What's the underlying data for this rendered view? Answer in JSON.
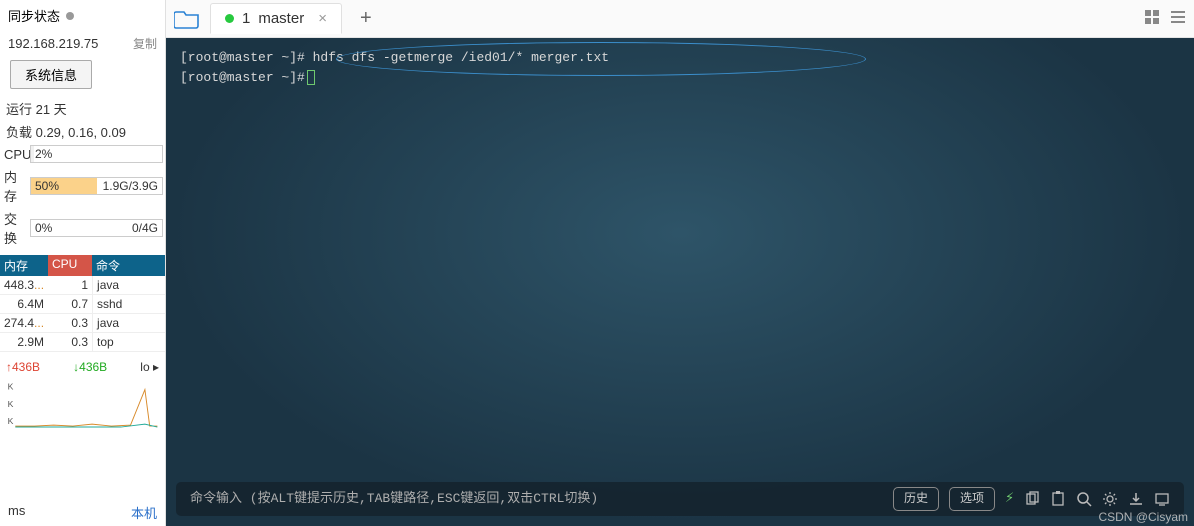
{
  "sidebar": {
    "sync_label": "同步状态",
    "ip": "192.168.219.75",
    "copy_label": "复制",
    "sys_info_btn": "系统信息",
    "uptime": "运行 21 天",
    "load": "负载 0.29, 0.16, 0.09",
    "cpu_label": "CPU",
    "cpu_pct": "2%",
    "mem_label": "内存",
    "mem_pct": "50%",
    "mem_detail": "1.9G/3.9G",
    "swap_label": "交换",
    "swap_pct": "0%",
    "swap_detail": "0/4G",
    "proc_headers": {
      "mem": "内存",
      "cpu": "CPU",
      "cmd": "命令"
    },
    "procs": [
      {
        "mem": "448.3",
        "cpu": "1",
        "cmd": "java"
      },
      {
        "mem": "6.4M",
        "cpu": "0.7",
        "cmd": "sshd"
      },
      {
        "mem": "274.4",
        "cpu": "0.3",
        "cmd": "java"
      },
      {
        "mem": "2.9M",
        "cpu": "0.3",
        "cmd": "top"
      }
    ],
    "net_up": "↑436B",
    "net_down": "↓436B",
    "net_if": "lo",
    "graph_labels": [
      "K",
      "K",
      "K"
    ],
    "bottom_left": "ms",
    "bottom_right": "本机"
  },
  "tabs": {
    "items": [
      {
        "index": "1",
        "label": "master"
      }
    ]
  },
  "terminal": {
    "lines": [
      {
        "prompt": "[root@master ~]#",
        "cmd": " hdfs dfs -getmerge /ied01/* merger.txt"
      },
      {
        "prompt": "[root@master ~]#",
        "cmd": ""
      }
    ]
  },
  "bottombar": {
    "hint": "命令输入 (按ALT键提示历史,TAB键路径,ESC键返回,双击CTRL切换)",
    "history_btn": "历史",
    "options_btn": "选项"
  },
  "watermark": "CSDN @Cisyam"
}
